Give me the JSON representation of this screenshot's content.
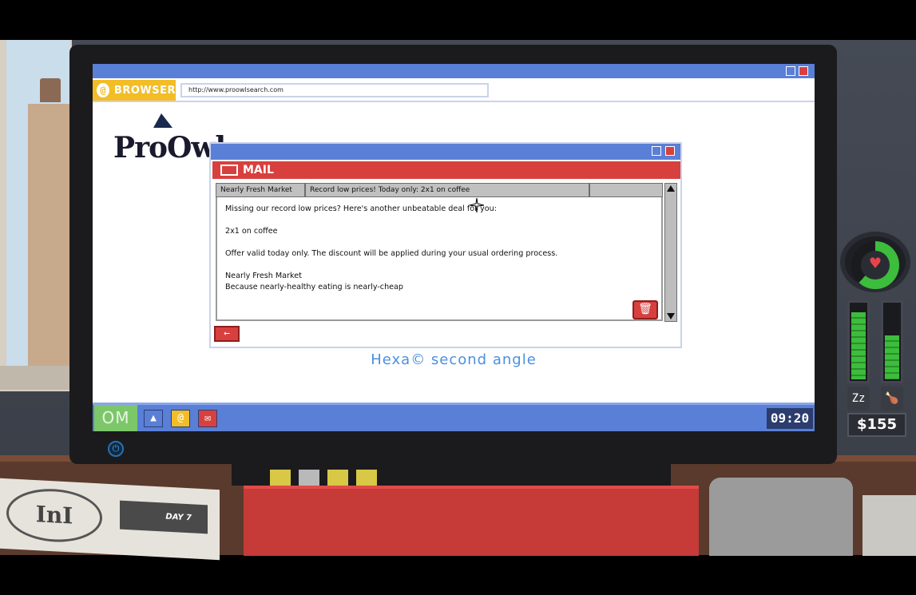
{
  "browser": {
    "tab_label": "BROWSER",
    "url": "http://www.proowlsearch.com",
    "logo_text": "ProOwl"
  },
  "page": {
    "center_text": "Hexa© second angle"
  },
  "mail": {
    "title": "MAIL",
    "sender": "Nearly Fresh Market",
    "subject": "Record low prices! Today only: 2x1 on coffee",
    "body_lines": [
      "Missing our record low prices? Here's another unbeatable deal for you:",
      "2x1 on coffee",
      "Offer valid today only. The discount will be applied during your usual ordering process.",
      "Nearly Fresh Market",
      "Because nearly-healthy eating is nearly-cheap"
    ]
  },
  "taskbar": {
    "start_label": "OM",
    "clock": "09:20"
  },
  "hud": {
    "money": "$155",
    "health_fraction": 0.62,
    "sleep_meter_fraction": 0.9,
    "food_meter_fraction": 0.6,
    "sleep_icon": "zz-icon",
    "food_icon": "drumstick-icon"
  },
  "newspaper": {
    "logo": "InI",
    "day": "DAY 7"
  },
  "colors": {
    "accent_blue": "#5a7fd6",
    "mail_red": "#d8403e",
    "browser_yellow": "#f2bd26",
    "health_green": "#3cbd3c"
  }
}
